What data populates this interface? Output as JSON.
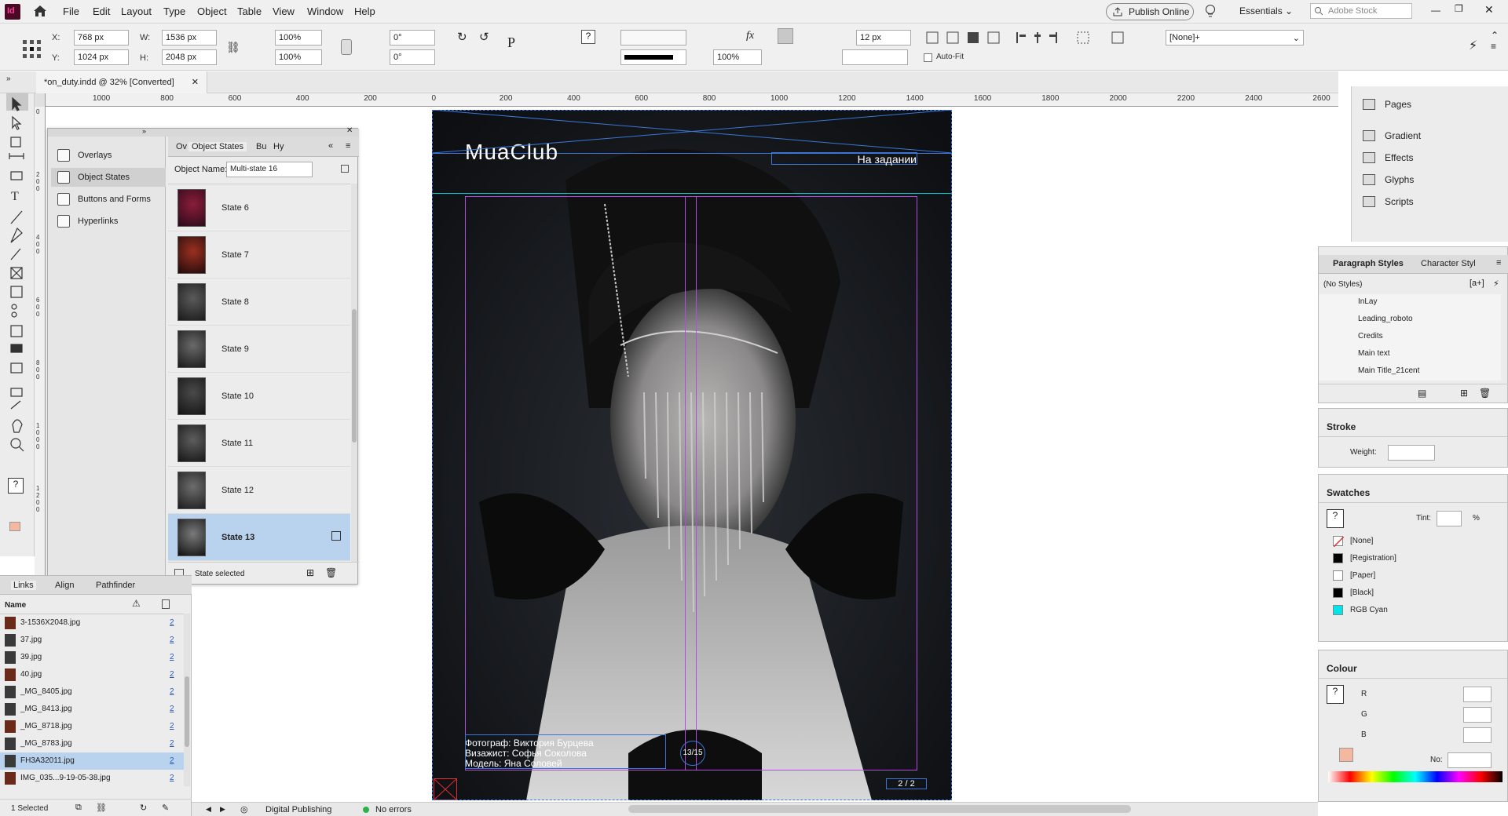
{
  "app": {
    "logo_text": "Id"
  },
  "menu": [
    "File",
    "Edit",
    "Layout",
    "Type",
    "Object",
    "Table",
    "View",
    "Window",
    "Help"
  ],
  "topbar": {
    "publish_label": "Publish Online",
    "workspace": "Essentials",
    "stock_placeholder": "Adobe Stock"
  },
  "control": {
    "x": "768 px",
    "y": "1024 px",
    "w": "1536 px",
    "h": "2048 px",
    "scale_x": "100%",
    "scale_y": "100%",
    "rotate": "0°",
    "shear": "0°",
    "stroke_weight": "12 px",
    "opacity": "100%",
    "autofit": "Auto-Fit",
    "object_style": "[None]+",
    "label_x": "X:",
    "label_y": "Y:",
    "label_w": "W:",
    "label_h": "H:"
  },
  "doc_tab": {
    "title": "*on_duty.indd @ 32% [Converted]"
  },
  "ruler": {
    "h": [
      "1000",
      "800",
      "600",
      "400",
      "200",
      "0",
      "200",
      "400",
      "600",
      "800",
      "1000",
      "1200",
      "1400",
      "1600",
      "1800",
      "2000",
      "2200",
      "2400",
      "2600"
    ],
    "v": [
      "0",
      "2\n0\n0",
      "4\n0\n0",
      "6\n0\n0",
      "8\n0\n0",
      "1\n0\n0\n0",
      "1\n2\n0\n0"
    ]
  },
  "nav_panel": {
    "items": [
      "Overlays",
      "Object States",
      "Buttons and Forms",
      "Hyperlinks"
    ]
  },
  "states_panel": {
    "tabs": [
      "Ov",
      "Object States",
      "Bu",
      "Hy"
    ],
    "object_name_label": "Object Name:",
    "object_name": "Multi-state 16",
    "states": [
      "State 6",
      "State 7",
      "State 8",
      "State 9",
      "State 10",
      "State 11",
      "State 12",
      "State 13"
    ],
    "footer": "State selected"
  },
  "links_panel": {
    "tabs": [
      "Links",
      "Align",
      "Pathfinder"
    ],
    "col_name": "Name",
    "rows": [
      {
        "name": "3-1536X2048.jpg",
        "page": "2"
      },
      {
        "name": "37.jpg",
        "page": "2"
      },
      {
        "name": "39.jpg",
        "page": "2"
      },
      {
        "name": "40.jpg",
        "page": "2"
      },
      {
        "name": "_MG_8405.jpg",
        "page": "2"
      },
      {
        "name": "_MG_8413.jpg",
        "page": "2"
      },
      {
        "name": "_MG_8718.jpg",
        "page": "2"
      },
      {
        "name": "_MG_8783.jpg",
        "page": "2"
      },
      {
        "name": "FH3A32011.jpg",
        "page": "2"
      },
      {
        "name": "IMG_035...9-19-05-38.jpg",
        "page": "2"
      }
    ],
    "footer": "1 Selected"
  },
  "document": {
    "brand": "MuaClub",
    "header_right": "На задании",
    "credit1": "Фотограф: Виктория Бурцева",
    "credit2": "Визажист: Софья Соколова",
    "credit3": "Модель: Яна Соловей",
    "badge": "13/15",
    "page_no": "2 / 2"
  },
  "right_dock": {
    "items": [
      "Pages",
      "Gradient",
      "Effects",
      "Glyphs",
      "Scripts"
    ]
  },
  "para_styles": {
    "tabs": [
      "Paragraph Styles",
      "Character Styl"
    ],
    "current": "(No Styles)",
    "items": [
      "InLay",
      "Leading_roboto",
      "Credits",
      "Main text",
      "Main Title_21cent"
    ]
  },
  "stroke": {
    "title": "Stroke",
    "weight_label": "Weight:"
  },
  "swatches": {
    "title": "Swatches",
    "tint_label": "Tint:",
    "tint_unit": "%",
    "items": [
      {
        "name": "[None]",
        "color": "#ffffff"
      },
      {
        "name": "[Registration]",
        "color": "#000000"
      },
      {
        "name": "[Paper]",
        "color": "#ffffff"
      },
      {
        "name": "[Black]",
        "color": "#000000"
      },
      {
        "name": "RGB Cyan",
        "color": "#00e5ea"
      }
    ]
  },
  "colour": {
    "title": "Colour",
    "r": "R",
    "g": "G",
    "b": "B",
    "no": "No:"
  },
  "status": {
    "mode": "Digital Publishing",
    "errors": "No errors"
  },
  "colors": {
    "selection": "#b9d3ef",
    "frame": "#3b76d6",
    "guide": "#b04de0",
    "cyan": "#00e5ea"
  }
}
